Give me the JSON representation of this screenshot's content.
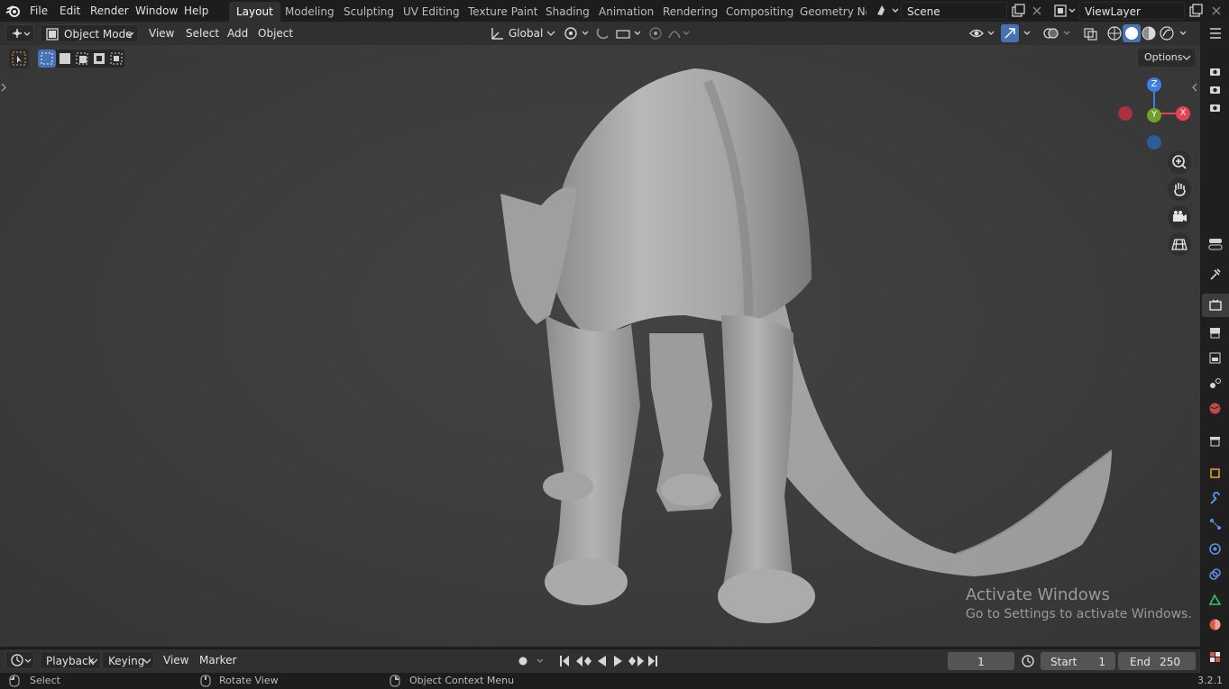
{
  "menu": [
    "File",
    "Edit",
    "Render",
    "Window",
    "Help"
  ],
  "workspace_tabs": [
    "Layout",
    "Modeling",
    "Sculpting",
    "UV Editing",
    "Texture Paint",
    "Shading",
    "Animation",
    "Rendering",
    "Compositing",
    "Geometry Noc"
  ],
  "active_tab": "Layout",
  "scene_name": "Scene",
  "view_layer": "ViewLayer",
  "viewport_header": {
    "mode": "Object Mode",
    "menus": [
      "View",
      "Select",
      "Add",
      "Object"
    ],
    "transform_orientation": "Global",
    "options_label": "Options"
  },
  "gizmo": {
    "z_label": "Z",
    "x_label": "X",
    "y_label": "Y"
  },
  "watermark": {
    "line1": "Activate Windows",
    "line2": "Go to Settings to activate Windows."
  },
  "timeline": {
    "menus": [
      "Playback",
      "Keying",
      "View",
      "Marker"
    ],
    "current_frame": "1",
    "start_label": "Start",
    "start_value": "1",
    "end_label": "End",
    "end_value": "250"
  },
  "statusbar": {
    "left_action": "Select",
    "middle_action": "Rotate View",
    "right_action": "Object Context Menu",
    "version": "3.2.1"
  },
  "colors": {
    "accent_blue": "#4772b3",
    "axis_x": "#e8414f",
    "axis_y": "#6ea02a",
    "axis_z": "#3f7fe2"
  }
}
